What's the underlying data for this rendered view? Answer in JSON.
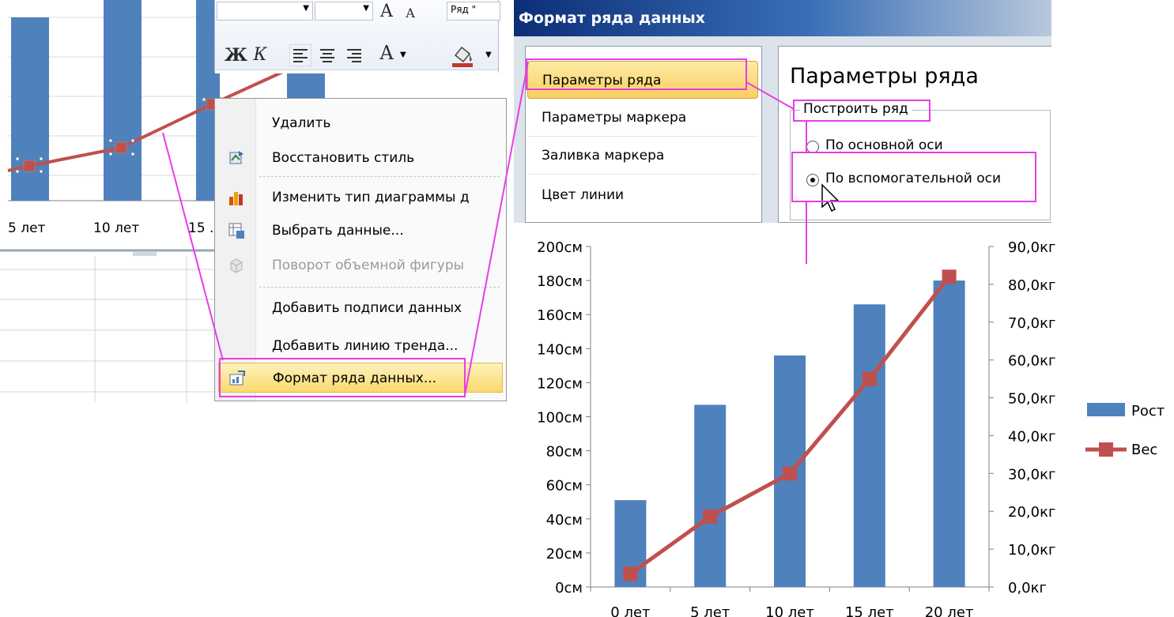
{
  "left_chart": {
    "x_labels": [
      "5 лет",
      "10 лет",
      "15 ."
    ]
  },
  "mini_toolbar": {
    "series_field": "Ряд \"",
    "bold": "Ж",
    "italic": "К",
    "grow_font": "A",
    "shrink_font": "A",
    "font_color": "A"
  },
  "context_menu": {
    "items": [
      {
        "label": "Удалить",
        "icon": "none",
        "enabled": true
      },
      {
        "label": "Восстановить стиль",
        "icon": "reset-style-icon",
        "enabled": true
      },
      {
        "label": "Изменить тип диаграммы д",
        "icon": "chart-type-icon",
        "enabled": true
      },
      {
        "label": "Выбрать данные...",
        "icon": "select-data-icon",
        "enabled": true
      },
      {
        "label": "Поворот объемной фигуры",
        "icon": "3d-rotation-icon",
        "enabled": false
      },
      {
        "label": "Добавить подписи данных",
        "icon": "none",
        "enabled": true
      },
      {
        "label": "Добавить линию тренда...",
        "icon": "none",
        "enabled": true
      },
      {
        "label": "Формат ряда данных...",
        "icon": "format-series-icon",
        "enabled": true,
        "highlighted": true
      }
    ]
  },
  "dialog": {
    "title": "Формат ряда данных",
    "nav": [
      "Параметры ряда",
      "Параметры маркера",
      "Заливка маркера",
      "Цвет линии"
    ],
    "selected_nav": "Параметры ряда",
    "panel_title": "Параметры ряда",
    "group_label": "Построить ряд",
    "radio_primary": "По основной оси",
    "radio_secondary": "По вспомогательной оси",
    "selected_radio": "По вспомогательной оси"
  },
  "chart_data": {
    "type": "bar",
    "categories": [
      "0 лет",
      "5 лет",
      "10 лет",
      "15 лет",
      "20 лет"
    ],
    "series": [
      {
        "name": "Рост",
        "type": "bar",
        "axis": "primary",
        "values": [
          51,
          107,
          136,
          166,
          180
        ],
        "color": "#4f81bd"
      },
      {
        "name": "Вес",
        "type": "line",
        "axis": "secondary",
        "values": [
          3.5,
          18.6,
          30.0,
          55.0,
          82.0
        ],
        "color": "#c0504d"
      }
    ],
    "y_ticks": [
      "0см",
      "20см",
      "40см",
      "60см",
      "80см",
      "100см",
      "120см",
      "140см",
      "160см",
      "180см",
      "200см"
    ],
    "y2_ticks": [
      "0,0кг",
      "10,0кг",
      "20,0кг",
      "30,0кг",
      "40,0кг",
      "50,0кг",
      "60,0кг",
      "70,0кг",
      "80,0кг",
      "90,0кг"
    ],
    "ylim": [
      0,
      200
    ],
    "y2lim": [
      0,
      90
    ],
    "legend": "right"
  }
}
